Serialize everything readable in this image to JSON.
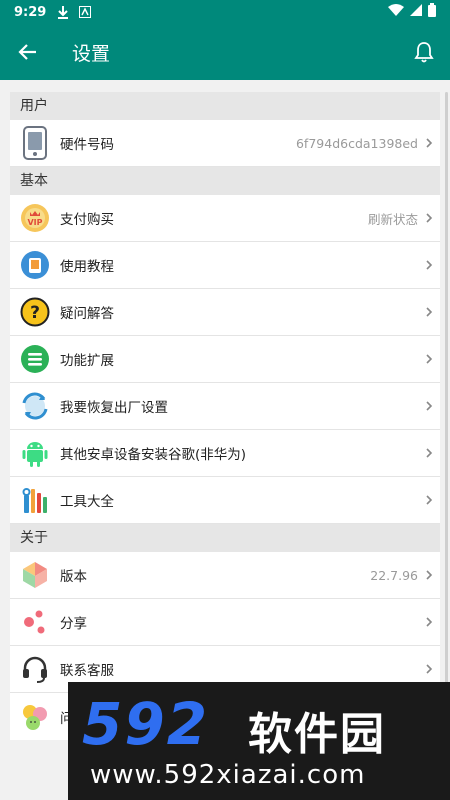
{
  "status_bar": {
    "time": "9:29"
  },
  "app_bar": {
    "title": "设置"
  },
  "sections": [
    {
      "header": "用户",
      "items": [
        {
          "icon": "phone-icon",
          "label": "硬件号码",
          "value": "6f794d6cda1398ed"
        }
      ]
    },
    {
      "header": "基本",
      "items": [
        {
          "icon": "vip-badge-icon",
          "label": "支付购买",
          "value": "刷新状态"
        },
        {
          "icon": "tutorial-icon",
          "label": "使用教程",
          "value": ""
        },
        {
          "icon": "question-icon",
          "label": "疑问解答",
          "value": ""
        },
        {
          "icon": "menu-list-icon",
          "label": "功能扩展",
          "value": ""
        },
        {
          "icon": "reset-icon",
          "label": "我要恢复出厂设置",
          "value": ""
        },
        {
          "icon": "android-icon",
          "label": "其他安卓设备安装谷歌(非华为)",
          "value": ""
        },
        {
          "icon": "tools-icon",
          "label": "工具大全",
          "value": ""
        }
      ]
    },
    {
      "header": "关于",
      "items": [
        {
          "icon": "version-cube-icon",
          "label": "版本",
          "value": "22.7.96"
        },
        {
          "icon": "share-icon",
          "label": "分享",
          "value": ""
        },
        {
          "icon": "headset-icon",
          "label": "联系客服",
          "value": ""
        },
        {
          "icon": "feedback-faces-icon",
          "label": "问",
          "value": ""
        }
      ]
    }
  ],
  "watermark": {
    "digits": "592",
    "brand": "软件园",
    "url": "www.592xiazai.com"
  },
  "colors": {
    "primary": "#00897b",
    "watermark_blue": "#2f6ef0"
  }
}
